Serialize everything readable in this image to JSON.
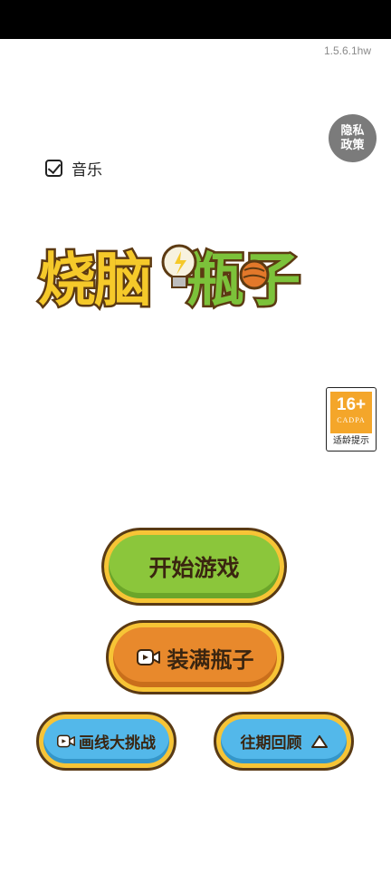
{
  "version": "1.5.6.1hw",
  "privacy": {
    "label": "隐私政策"
  },
  "music": {
    "label": "音乐",
    "checked": true
  },
  "logo": {
    "part1": "烧脑",
    "part2": "瓶子"
  },
  "age_rating": {
    "number": "16+",
    "org": "CADPA",
    "label": "适龄提示"
  },
  "buttons": {
    "start": "开始游戏",
    "fill": "装满瓶子",
    "draw": "画线大挑战",
    "past": "往期回顾"
  },
  "colors": {
    "green": "#8bc63b",
    "orange": "#e8892c",
    "blue": "#53b8ea",
    "gold": "#f7c436"
  }
}
